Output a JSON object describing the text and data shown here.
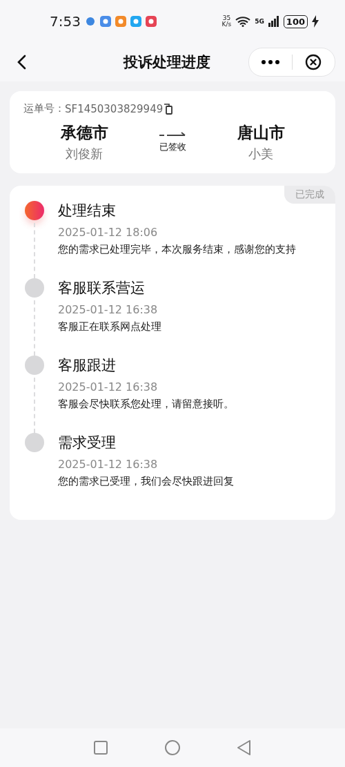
{
  "status_bar": {
    "time": "7:53",
    "net_speed_value": "35",
    "net_speed_unit": "K/s",
    "network": "5G",
    "battery": "100"
  },
  "nav": {
    "title": "投诉处理进度"
  },
  "waybill": {
    "label": "运单号：",
    "number": "SF1450303829949",
    "from_city": "承德市",
    "from_name": "刘俊新",
    "status": "已签收",
    "to_city": "唐山市",
    "to_name": "小美"
  },
  "progress": {
    "badge": "已完成",
    "steps": [
      {
        "title": "处理结束",
        "time": "2025-01-12 18:06",
        "desc": "您的需求已处理完毕，本次服务结束，感谢您的支持",
        "current": true
      },
      {
        "title": "客服联系营运",
        "time": "2025-01-12 16:38",
        "desc": "客服正在联系网点处理",
        "current": false
      },
      {
        "title": "客服跟进",
        "time": "2025-01-12 16:38",
        "desc": "客服会尽快联系您处理，请留意接听。",
        "current": false
      },
      {
        "title": "需求受理",
        "time": "2025-01-12 16:38",
        "desc": "您的需求已受理，我们会尽快跟进回复",
        "current": false
      }
    ]
  }
}
